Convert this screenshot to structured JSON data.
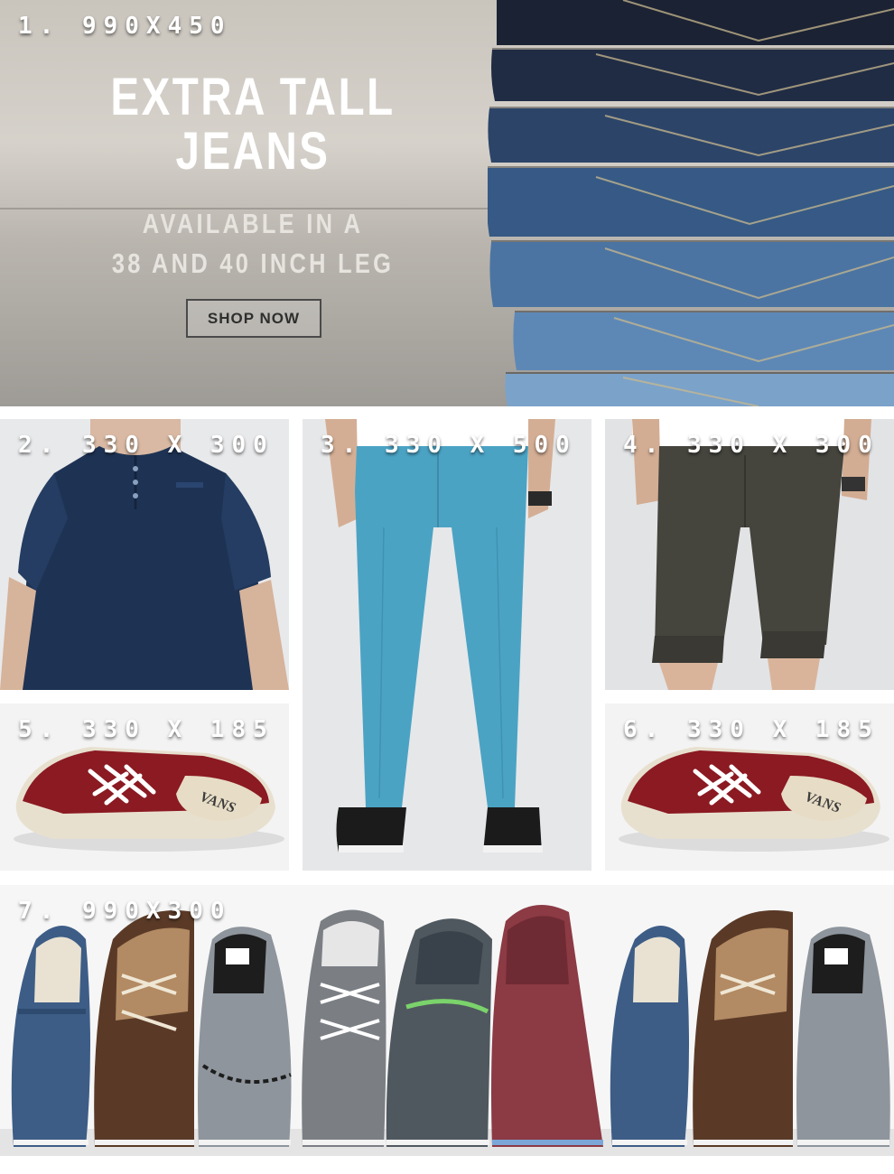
{
  "tiles": {
    "hero": {
      "tag": "1. 990X450",
      "title_line1": "EXTRA TALL",
      "title_line2": "JEANS",
      "subtitle_line1": "AVAILABLE IN A",
      "subtitle_line2": "38 AND 40 INCH LEG",
      "cta": "SHOP NOW"
    },
    "t2": {
      "tag": "2. 330 X 300"
    },
    "t3": {
      "tag": "3. 330 X 500"
    },
    "t4": {
      "tag": "4. 330 X 300"
    },
    "t5": {
      "tag": "5. 330 X 185"
    },
    "t6": {
      "tag": "6. 330 X 185"
    },
    "t7": {
      "tag": "7. 990X300"
    }
  },
  "colors": {
    "denim_dark": "#1f2b43",
    "denim_light": "#6d95bf",
    "henley_navy": "#1e3354",
    "chino_blue": "#4ba3c4",
    "shorts_olive": "#45443d",
    "vans_burgundy": "#8b1a22"
  },
  "icons": {
    "shoe_brand": "vans-logo"
  }
}
